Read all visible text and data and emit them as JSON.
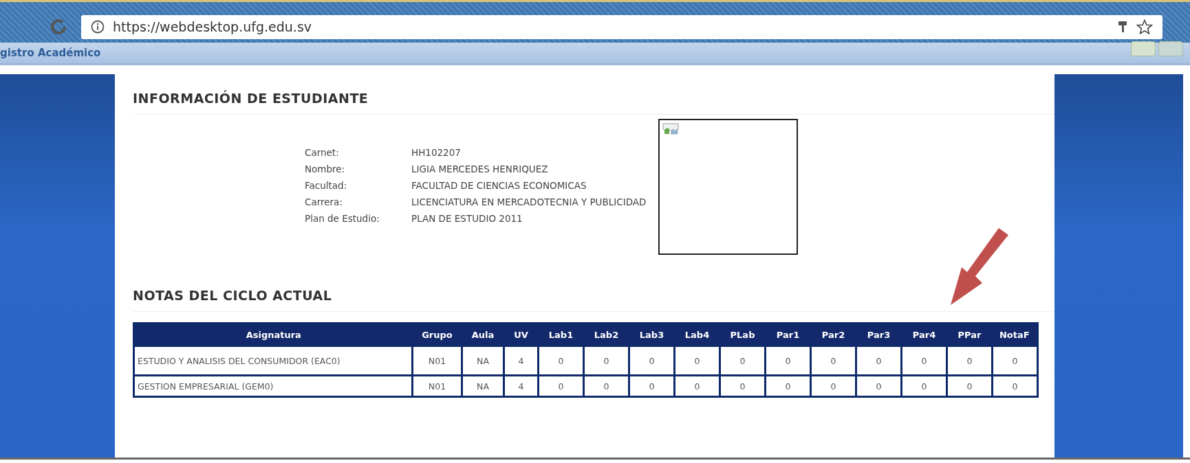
{
  "browser": {
    "url": "https://webdesktop.ufg.edu.sv"
  },
  "app_header": {
    "title": "gistro Académico"
  },
  "student_info": {
    "heading": "INFORMACIÓN DE ESTUDIANTE",
    "fields": [
      {
        "label": "Carnet:",
        "value": "HH102207"
      },
      {
        "label": "Nombre:",
        "value": "LIGIA MERCEDES HENRIQUEZ"
      },
      {
        "label": "Facultad:",
        "value": "FACULTAD DE CIENCIAS ECONOMICAS"
      },
      {
        "label": "Carrera:",
        "value": "LICENCIATURA EN MERCADOTECNIA Y PUBLICIDAD"
      },
      {
        "label": "Plan de Estudio:",
        "value": "PLAN DE ESTUDIO 2011"
      }
    ],
    "photo": {
      "kind": "broken_image"
    }
  },
  "grades": {
    "heading": "NOTAS DEL CICLO ACTUAL",
    "columns": [
      "Asignatura",
      "Grupo",
      "Aula",
      "UV",
      "Lab1",
      "Lab2",
      "Lab3",
      "Lab4",
      "PLab",
      "Par1",
      "Par2",
      "Par3",
      "Par4",
      "PPar",
      "NotaF"
    ],
    "rows": [
      [
        "ESTUDIO Y ANALISIS DEL CONSUMIDOR (EAC0)",
        "N01",
        "NA",
        "4",
        "0",
        "0",
        "0",
        "0",
        "0",
        "0",
        "0",
        "0",
        "0",
        "0",
        "0"
      ],
      [
        "GESTION EMPRESARIAL (GEM0)",
        "N01",
        "NA",
        "4",
        "0",
        "0",
        "0",
        "0",
        "0",
        "0",
        "0",
        "0",
        "0",
        "0",
        "0"
      ]
    ]
  },
  "annotations": [
    {
      "kind": "arrow"
    }
  ]
}
